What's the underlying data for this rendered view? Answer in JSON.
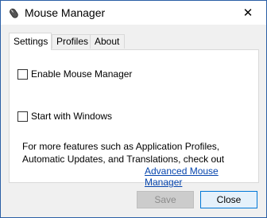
{
  "window": {
    "title": "Mouse Manager",
    "close_glyph": "✕"
  },
  "tabs": [
    {
      "label": "Settings",
      "active": true
    },
    {
      "label": "Profiles",
      "active": false
    },
    {
      "label": "About",
      "active": false
    }
  ],
  "settings": {
    "enable_label": "Enable Mouse Manager",
    "enable_checked": false,
    "startup_label": "Start with Windows",
    "startup_checked": false,
    "info_line1": "For more features such as Application Profiles,",
    "info_line2": "Automatic Updates, and Translations, check out",
    "link_text": "Advanced Mouse Manager"
  },
  "buttons": {
    "save": "Save",
    "close": "Close"
  },
  "icons": {
    "app": "mouse-icon",
    "close": "close-icon"
  },
  "colors": {
    "link": "#0645ad",
    "accent": "#0078d7"
  }
}
